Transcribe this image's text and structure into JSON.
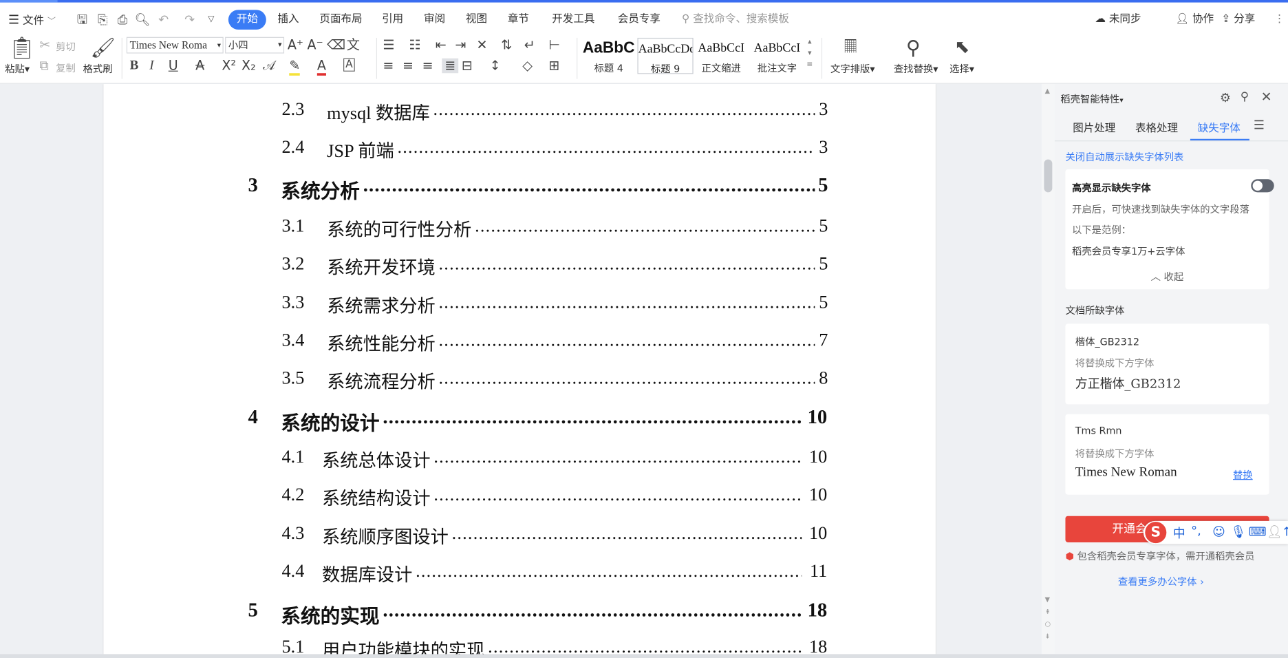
{
  "menubar": {
    "file_label": "文件",
    "tabs": [
      "开始",
      "插入",
      "页面布局",
      "引用",
      "审阅",
      "视图",
      "章节",
      "开发工具",
      "会员专享"
    ],
    "search_placeholder": "查找命令、搜索模板",
    "sync_label": "未同步",
    "collab_label": "协作",
    "share_label": "分享"
  },
  "ribbon": {
    "paste": "粘贴",
    "cut": "剪切",
    "copy": "复制",
    "format_painter": "格式刷",
    "font_name": "Times New Roma",
    "font_size": "小四",
    "styles": [
      {
        "preview": "AaBbC",
        "name": "标题 4"
      },
      {
        "preview": "AaBbCcDd",
        "name": "标题 9"
      },
      {
        "preview": "AaBbCcI",
        "name": "正文缩进"
      },
      {
        "preview": "AaBbCcI",
        "name": "批注文字"
      }
    ],
    "text_layout": "文字排版",
    "find_replace": "查找替换",
    "select": "选择"
  },
  "toc": [
    {
      "num": "2.3",
      "title": "mysql 数据库",
      "page": "3",
      "level": 2
    },
    {
      "num": "2.4",
      "title": "JSP 前端",
      "page": "3",
      "level": 2
    },
    {
      "num": "3",
      "title": "系统分析",
      "page": "5",
      "level": 1
    },
    {
      "num": "3.1",
      "title": "系统的可行性分析",
      "page": "5",
      "level": 2
    },
    {
      "num": "3.2",
      "title": "系统开发环境",
      "page": "5",
      "level": 2
    },
    {
      "num": "3.3",
      "title": "系统需求分析",
      "page": "5",
      "level": 2
    },
    {
      "num": "3.4",
      "title": "系统性能分析",
      "page": "7",
      "level": 2
    },
    {
      "num": "3.5",
      "title": "系统流程分析",
      "page": "8",
      "level": 2
    },
    {
      "num": "4",
      "title": "系统的设计",
      "page": "10",
      "level": 1
    },
    {
      "num": "4.1",
      "title": "系统总体设计",
      "page": "10",
      "level": 2
    },
    {
      "num": "4.2",
      "title": "系统结构设计",
      "page": "10",
      "level": 2
    },
    {
      "num": "4.3",
      "title": "系统顺序图设计",
      "page": "10",
      "level": 2
    },
    {
      "num": "4.4",
      "title": "数据库设计",
      "page": "11",
      "level": 2
    },
    {
      "num": "5",
      "title": "系统的实现",
      "page": "18",
      "level": 1
    },
    {
      "num": "5.1",
      "title": "用户功能模块的实现",
      "page": "18",
      "level": 2
    }
  ],
  "panel": {
    "title": "稻壳智能特性",
    "tabs": [
      "图片处理",
      "表格处理",
      "缺失字体"
    ],
    "close_auto": "关闭自动展示缺失字体列表",
    "highlight_title": "高亮显示缺失字体",
    "highlight_desc": "开启后，可快速找到缺失字体的文字段落",
    "example_label": "以下是范例：",
    "example_text": "稻壳会员专享1万+云字体",
    "collapse": "收起",
    "missing_title": "文档所缺字体",
    "fonts": [
      {
        "name": "楷体_GB2312",
        "hint": "将替换成下方字体",
        "replace": "方正楷体_GB2312",
        "action": ""
      },
      {
        "name": "Tms Rmn",
        "hint": "将替换成下方字体",
        "replace": "Times New Roman",
        "action": "替换"
      }
    ],
    "open_btn": "开通会",
    "member_note": "包含稻壳会员专享字体，需开通稻壳会员",
    "more_fonts": "查看更多办公字体"
  },
  "ime": {
    "mode": "中",
    "punct": "°,"
  }
}
